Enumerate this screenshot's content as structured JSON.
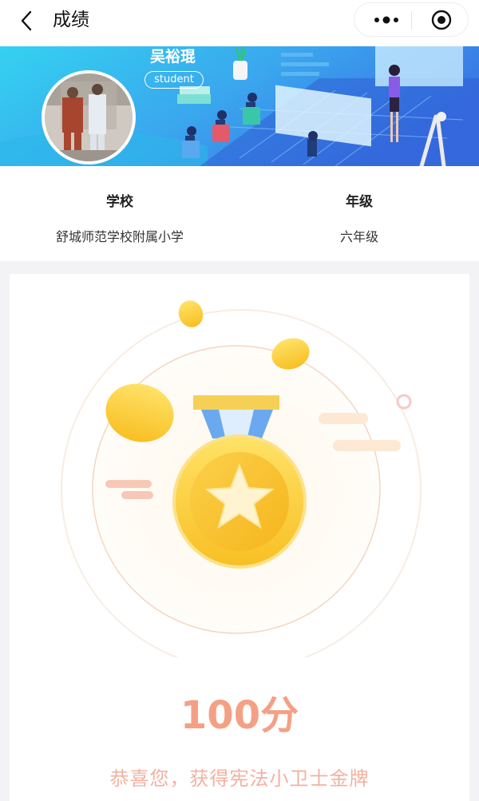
{
  "nav": {
    "title": "成绩"
  },
  "student": {
    "name": "吴裕琨",
    "tag": "student"
  },
  "info": {
    "school_label": "学校",
    "school_value": "舒城师范学校附属小学",
    "grade_label": "年级",
    "grade_value": "六年级"
  },
  "result": {
    "score": "100分",
    "message": "恭喜您，获得宪法小卫士金牌"
  },
  "colors": {
    "score": "#f4a085",
    "banner_start": "#2ec7ef",
    "banner_end": "#3a6fe0",
    "medal_gold": "#fcd23a"
  }
}
